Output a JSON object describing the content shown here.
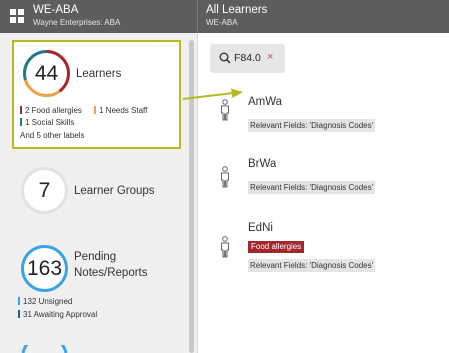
{
  "app": {
    "title": "WE-ABA",
    "subtitle": "Wayne Enterprises: ABA"
  },
  "page": {
    "title": "All Learners",
    "subtitle": "WE-ABA"
  },
  "sidebar": {
    "cards": [
      {
        "count": "44",
        "label": "Learners",
        "selected": true,
        "tags": [
          {
            "text": "2 Food allergies",
            "color": "#a5262b"
          },
          {
            "text": "1 Needs Staff",
            "color": "#f0a04b"
          },
          {
            "text": "1 Social Skills",
            "color": "#1f7a8c"
          }
        ],
        "more": "And 5 other labels"
      },
      {
        "count": "7",
        "label": "Learner Groups"
      },
      {
        "count": "163",
        "label": "Pending Notes/Reports",
        "label_line1": "Pending",
        "label_line2": "Notes/Reports",
        "tags": [
          {
            "text": "132 Unsigned",
            "color": "#3aa3e3"
          },
          {
            "text": "31 Awaiting Approval",
            "color": "#1f5fa8"
          }
        ]
      }
    ]
  },
  "filter": {
    "value": "F84.0",
    "close": "×"
  },
  "learners": [
    {
      "name": "AmWa",
      "field": "Relevant Fields: 'Diagnosis Codes'"
    },
    {
      "name": "BrWa",
      "field": "Relevant Fields: 'Diagnosis Codes'"
    },
    {
      "name": "EdNi",
      "badge": "Food allergies",
      "field": "Relevant Fields: 'Diagnosis Codes'"
    }
  ],
  "colors": {
    "topbar": "#5d5d5d",
    "highlight": "#b8b820",
    "ring_teal": "#1f7a8c",
    "ring_red": "#a5262b",
    "ring_orange": "#f0a04b",
    "ring_blue": "#3aa3e3",
    "alert": "#a5262b"
  }
}
